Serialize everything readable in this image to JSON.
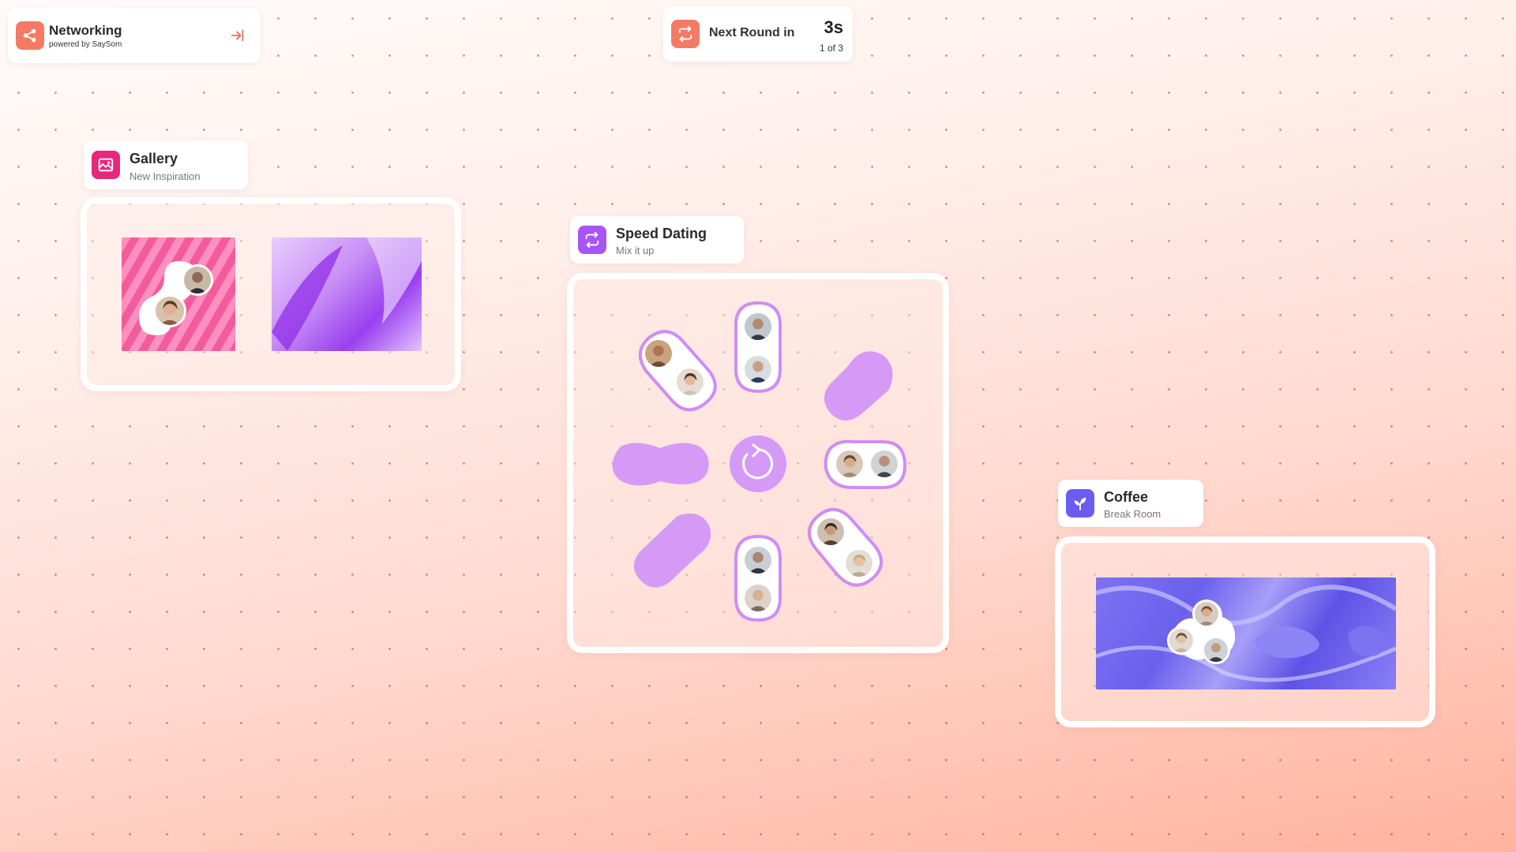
{
  "app": {
    "title": "Networking",
    "subtitle": "powered by SaySom",
    "icon": "network-share-icon",
    "exit_icon": "exit-icon",
    "accent": "#f47a64"
  },
  "round": {
    "label": "Next Round in",
    "countdown": "3s",
    "progress": "1 of 3",
    "icon": "repeat-icon"
  },
  "rooms": {
    "gallery": {
      "title": "Gallery",
      "subtitle": "New Inspiration",
      "icon": "image-icon",
      "color": "#e8287b"
    },
    "speed_dating": {
      "title": "Speed Dating",
      "subtitle": "Mix it up",
      "icon": "repeat-icon",
      "color": "#a855f7",
      "center_icon": "rotate-icon"
    },
    "coffee": {
      "title": "Coffee",
      "subtitle": "Break Room",
      "icon": "sprout-icon",
      "color": "#6a5cf0"
    }
  },
  "colors": {
    "seat_purple": "#d49af5",
    "seat_ring": "#c47fef",
    "gallery_pink": "#f25c9c",
    "gallery_violet": "#b36ef0",
    "coffee_blue": "#6b60ec"
  }
}
